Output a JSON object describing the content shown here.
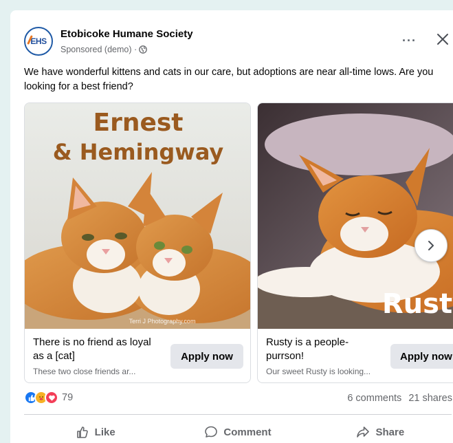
{
  "post": {
    "page_name": "Etobicoke Humane Society",
    "avatar_text": "EHS",
    "meta_text": "Sponsored (demo) ·",
    "body": "We have wonderful kittens and cats in our care, but adoptions are near all-time lows. Are you looking for a best friend?"
  },
  "carousel": [
    {
      "title_line1": "Ernest",
      "title_line2": "& Hemingway",
      "photo_credit": "Terri J Photography.com",
      "headline": "There is no friend as loyal as a [cat]",
      "description": "These two close friends ar...",
      "button": "Apply now"
    },
    {
      "title": "Rusty",
      "headline": "Rusty is a people-purrson!",
      "description": "Our sweet Rusty is looking...",
      "button": "Apply now"
    }
  ],
  "stats": {
    "reaction_count": "79",
    "comments": "6 comments",
    "shares": "21 shares"
  },
  "actions": {
    "like": "Like",
    "comment": "Comment",
    "share": "Share"
  },
  "colors": {
    "background": "#e4f1f1",
    "title_brown": "#9a5a1f",
    "like_blue": "#1877f2",
    "love_red": "#f33e58"
  }
}
